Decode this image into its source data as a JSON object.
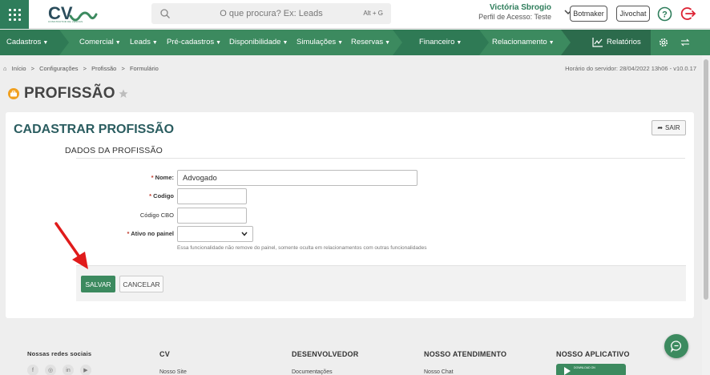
{
  "colors": {
    "brand": "#3c8a5f",
    "title": "#2b5d60",
    "required": "#c0392b",
    "arrow": "#e01b1b"
  },
  "header": {
    "logo_text": "CV",
    "logo_subtitle": "CONSTRUTOR DE VENDAS",
    "search_placeholder": "O que procura? Ex: Leads",
    "search_shortcut": "Alt + G",
    "user_name": "Victória Sbrogio",
    "user_profile": "Perfil de Acesso: Teste",
    "botmaker_label": "Botmaker",
    "jivochat_label": "Jivochat"
  },
  "nav": {
    "items": [
      {
        "label": "Cadastros"
      },
      {
        "label": "Comercial"
      },
      {
        "label": "Leads"
      },
      {
        "label": "Pré-cadastros"
      },
      {
        "label": "Disponibilidade"
      },
      {
        "label": "Simulações"
      },
      {
        "label": "Reservas"
      },
      {
        "label": "Financeiro"
      },
      {
        "label": "Relacionamento"
      }
    ],
    "reports_label": "Relatórios"
  },
  "breadcrumb": {
    "items": [
      "Início",
      "Configurações",
      "Profissão",
      "Formulário"
    ],
    "separator": ">",
    "server_time": "Horário do servidor: 28/04/2022 13h06 - v10.0.17"
  },
  "page": {
    "title": "PROFISSÃO"
  },
  "form": {
    "card_title": "CADASTRAR PROFISSÃO",
    "exit_label": "SAIR",
    "section_title": "DADOS DA PROFISSÃO",
    "required_mark": "*",
    "fields": {
      "nome": {
        "label": "Nome:",
        "value": "Advogado"
      },
      "codigo": {
        "label": "Codigo",
        "value": ""
      },
      "codigo_cbo": {
        "label": "Código CBO",
        "value": ""
      },
      "ativo": {
        "label": "Ativo no painel",
        "value": ""
      }
    },
    "help_text": "Essa funcionalidade não remove do painel, somente oculta em relacionamentos com outras funcionalidades",
    "save_label": "SALVAR",
    "cancel_label": "CANCELAR"
  },
  "footer": {
    "social_title": "Nossas redes sociais",
    "social_icons": [
      "f",
      "◎",
      "in",
      "▶"
    ],
    "cv_title": "CV",
    "cv_link": "Nosso Site",
    "dev_title": "DESENVOLVEDOR",
    "dev_link": "Documentações",
    "support_title": "NOSSO ATENDIMENTO",
    "support_link": "Nosso Chat",
    "app_title": "NOSSO APLICATIVO",
    "app_badge": "DOWNLOAD ON"
  }
}
